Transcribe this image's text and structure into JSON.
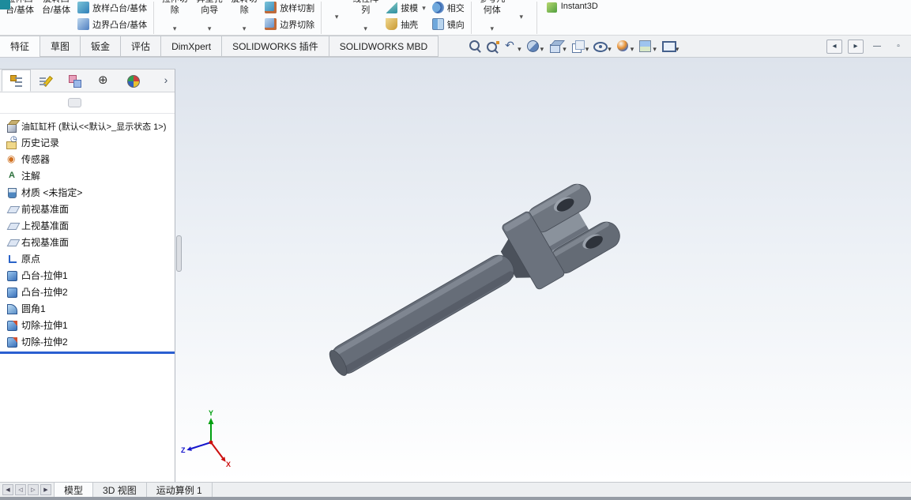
{
  "colors": {
    "accent_blue": "#2a5fd0",
    "viewport_top": "#dde3ec",
    "viewport_mid": "#edf1f6",
    "viewport_bottom": "#ffffff",
    "model_body": "#666d78",
    "model_dark": "#4b515b",
    "model_light": "#8d949e",
    "triad_x": "#cc1010",
    "triad_y": "#00a010",
    "triad_z": "#1515cc"
  },
  "ribbon": {
    "icons": [
      "loft-boss-icon",
      "boundary-boss-icon",
      "loft-cut-icon",
      "boundary-cut-icon",
      "draft-icon",
      "shell-icon",
      "intersect-icon",
      "mirror-icon",
      "instant3d-icon",
      "dropdown-caret-icon"
    ],
    "extrude_boss": {
      "l1": "拉伸凸",
      "l2": "台/基体"
    },
    "revolve_boss": {
      "l1": "旋转凸",
      "l2": "台/基体"
    },
    "loft_boss": "放样凸台/基体",
    "boundary_boss": "边界凸台/基体",
    "extrude_cut": {
      "l1": "拉伸切",
      "l2": "除"
    },
    "hole_wizard": {
      "l1": "异型孔",
      "l2": "向导"
    },
    "revolve_cut": {
      "l1": "旋转切",
      "l2": "除"
    },
    "loft_cut": "放样切割",
    "boundary_cut": "边界切除",
    "fillet": {
      "l1": "",
      "l2": ""
    },
    "linear_pattern": {
      "l1": "线性阵",
      "l2": "列"
    },
    "draft": "拔模",
    "shell": "抽壳",
    "intersect": "相交",
    "mirror": "镜向",
    "reference_geometry": {
      "l1": "参考几",
      "l2": "何体"
    },
    "curves": {
      "l1": "",
      "l2": ""
    },
    "instant3d": "Instant3D"
  },
  "command_tabs": {
    "items": [
      {
        "label": "特征",
        "state": "active",
        "name": "tab-features"
      },
      {
        "label": "草图",
        "name": "tab-sketch"
      },
      {
        "label": "钣金",
        "name": "tab-sheet-metal"
      },
      {
        "label": "评估",
        "name": "tab-evaluate"
      },
      {
        "label": "DimXpert",
        "name": "tab-dimxpert"
      },
      {
        "label": "SOLIDWORKS 插件",
        "name": "tab-solidworks-addins"
      },
      {
        "label": "SOLIDWORKS MBD",
        "name": "tab-solidworks-mbd"
      }
    ]
  },
  "headsup": {
    "buttons": [
      {
        "icon": "zoom-fit",
        "name": "zoom-to-fit-button"
      },
      {
        "icon": "zoom-area",
        "name": "zoom-to-area-button"
      },
      {
        "icon": "previous-view",
        "caret": true,
        "name": "previous-view-button"
      },
      {
        "icon": "section-view",
        "caret": true,
        "name": "section-view-button"
      },
      {
        "icon": "view-orientation",
        "caret": true,
        "name": "view-orientation-button"
      },
      {
        "icon": "display-style",
        "caret": true,
        "name": "display-style-button"
      },
      {
        "icon": "hide-show",
        "caret": true,
        "name": "hide-show-items-button"
      },
      {
        "icon": "edit-appearance",
        "caret": true,
        "name": "edit-appearance-button"
      },
      {
        "icon": "apply-scene",
        "caret": true,
        "name": "apply-scene-button"
      },
      {
        "icon": "view-settings",
        "caret": true,
        "name": "view-settings-button"
      }
    ]
  },
  "window_controls": {
    "buttons": [
      {
        "glyph": "◂",
        "cls": "boxed",
        "name": "collapse-pane-left-button"
      },
      {
        "glyph": "▸",
        "cls": "boxed",
        "name": "collapse-pane-right-button"
      },
      {
        "glyph": "—",
        "cls": "plain",
        "name": "minimize-button"
      },
      {
        "glyph": "▫",
        "cls": "plain",
        "name": "restore-button"
      }
    ]
  },
  "panel": {
    "tabs": [
      {
        "icon": "featuremanager",
        "state": "active",
        "name": "featuremanager-tree-tab"
      },
      {
        "icon": "propertymanager",
        "name": "propertymanager-tab"
      },
      {
        "icon": "configurationmanager",
        "name": "configurationmanager-tab"
      },
      {
        "icon": "dimxpertmanager",
        "name": "dimxpertmanager-tab"
      },
      {
        "icon": "displaymanager",
        "name": "displaymanager-tab"
      }
    ],
    "expand_arrow": "›"
  },
  "feature_tree": {
    "root": {
      "label": "油缸缸杆 (默认<<默认>_显示状态 1>)",
      "icon": "part"
    },
    "items": [
      {
        "label": "历史记录",
        "icon": "history"
      },
      {
        "label": "传感器",
        "icon": "sensors"
      },
      {
        "label": "注解",
        "icon": "annotations"
      },
      {
        "label": "材质 <未指定>",
        "icon": "material"
      },
      {
        "label": "前视基准面",
        "icon": "plane"
      },
      {
        "label": "上视基准面",
        "icon": "plane"
      },
      {
        "label": "右视基准面",
        "icon": "plane"
      },
      {
        "label": "原点",
        "icon": "origin"
      },
      {
        "label": "凸台-拉伸1",
        "icon": "boss-extrude"
      },
      {
        "label": "凸台-拉伸2",
        "icon": "boss-extrude"
      },
      {
        "label": "圆角1",
        "icon": "fillet"
      },
      {
        "label": "切除-拉伸1",
        "icon": "cut-extrude"
      },
      {
        "label": "切除-拉伸2",
        "icon": "cut-extrude"
      }
    ]
  },
  "viewport": {
    "triad": {
      "x": "X",
      "y": "Y",
      "z": "Z"
    }
  },
  "bottom": {
    "nav": [
      {
        "glyph": "◀",
        "name": "tab-scroll-first-button"
      },
      {
        "glyph": "◁",
        "name": "tab-scroll-left-button"
      },
      {
        "glyph": "▷",
        "name": "tab-scroll-right-button"
      },
      {
        "glyph": "▶",
        "name": "tab-scroll-last-button"
      }
    ],
    "tabs": [
      {
        "label": "模型",
        "state": "active",
        "name": "model-tab"
      },
      {
        "label": "3D 视图",
        "name": "3d-views-tab"
      },
      {
        "label": "运动算例 1",
        "name": "motion-study-1-tab"
      }
    ]
  }
}
